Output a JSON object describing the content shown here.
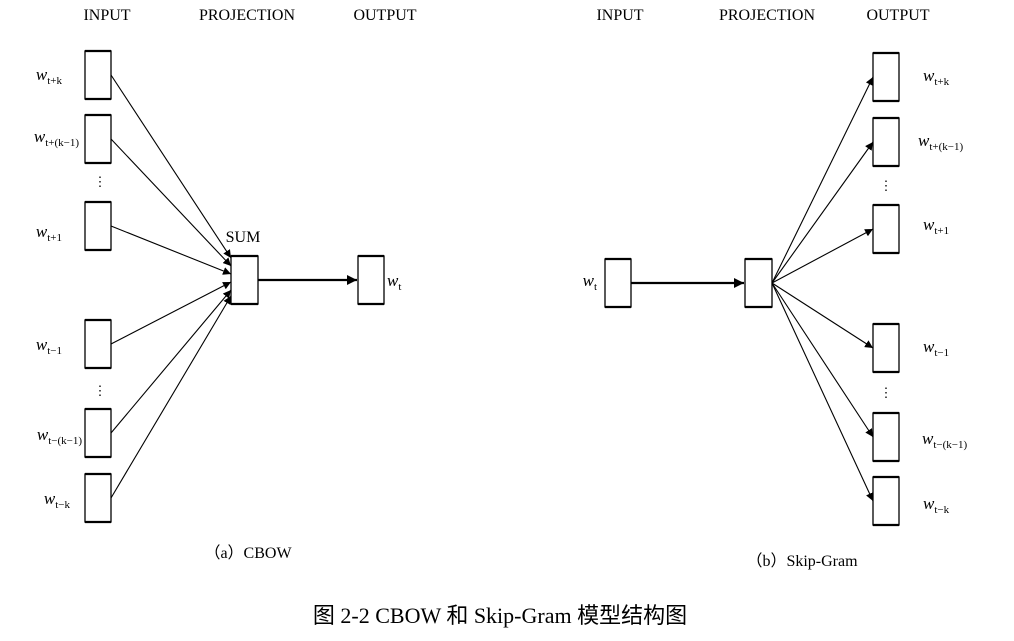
{
  "cbow": {
    "headers": {
      "input": "INPUT",
      "projection": "PROJECTION",
      "output": "OUTPUT"
    },
    "sum_label": "SUM",
    "inputs": [
      {
        "base": "w",
        "sub": "t+k"
      },
      {
        "base": "w",
        "sub": "t+(k−1)"
      },
      {
        "base": "w",
        "sub": "t+1"
      },
      {
        "base": "w",
        "sub": "t−1"
      },
      {
        "base": "w",
        "sub": "t−(k−1)"
      },
      {
        "base": "w",
        "sub": "t−k"
      }
    ],
    "output": {
      "base": "w",
      "sub": "t"
    },
    "ellipsis": "⋮",
    "caption": "（a）CBOW"
  },
  "skipgram": {
    "headers": {
      "input": "INPUT",
      "projection": "PROJECTION",
      "output": "OUTPUT"
    },
    "input": {
      "base": "w",
      "sub": "t"
    },
    "outputs": [
      {
        "base": "w",
        "sub": "t+k"
      },
      {
        "base": "w",
        "sub": "t+(k−1)"
      },
      {
        "base": "w",
        "sub": "t+1"
      },
      {
        "base": "w",
        "sub": "t−1"
      },
      {
        "base": "w",
        "sub": "t−(k−1)"
      },
      {
        "base": "w",
        "sub": "t−k"
      }
    ],
    "ellipsis": "⋮",
    "caption": "（b）Skip-Gram"
  },
  "figure_caption": "图 2-2 CBOW 和 Skip-Gram 模型结构图"
}
